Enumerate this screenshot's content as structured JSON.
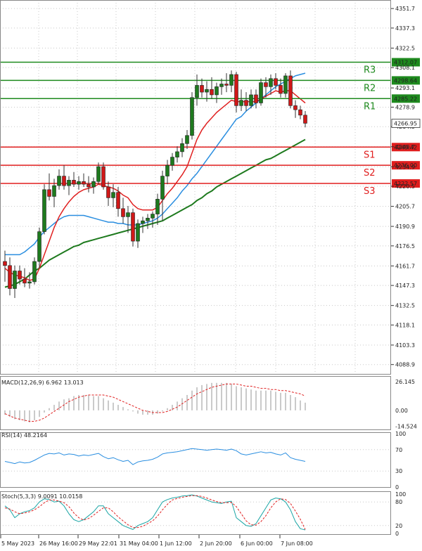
{
  "chart_data": {
    "type": "candlestick",
    "price_axis": {
      "ylim": [
        4082,
        4358
      ],
      "ticks": [
        4088.9,
        4103.3,
        4118.1,
        4132.5,
        4147.3,
        4161.7,
        4176.5,
        4190.9,
        4205.7,
        4220.5,
        4234.9,
        4249.7,
        4264.5,
        4278.9,
        4293.1,
        4308.1,
        4322.5,
        4337.3,
        4351.7
      ]
    },
    "x_labels": [
      "5 May 2023",
      "26 May 16:00",
      "29 May 22:01",
      "31 May 04:00",
      "1 Jun 12:00",
      "2 Jun 20:00",
      "6 Jun 00:00",
      "7 Jun 08:00"
    ],
    "levels": [
      {
        "name": "R3",
        "value": 4312.07,
        "value_label": "4312.07",
        "color": "#1e8a1e"
      },
      {
        "name": "R2",
        "value": 4298.64,
        "value_label": "4298.64",
        "color": "#1e8a1e"
      },
      {
        "name": "R1",
        "value": 4285.22,
        "value_label": "4285.22",
        "color": "#1e8a1e"
      },
      {
        "name": "S1",
        "value": 4249.42,
        "value_label": "4249.42",
        "color": "#e01e1e"
      },
      {
        "name": "S2",
        "value": 4236.0,
        "value_label": "4236.00",
        "color": "#e01e1e"
      },
      {
        "name": "S3",
        "value": 4222.57,
        "value_label": "4222.57",
        "color": "#e01e1e"
      }
    ],
    "current_price": {
      "value": 4266.95,
      "label": "4266.95"
    },
    "candles": [
      [
        4165,
        4173,
        4150,
        4162
      ],
      [
        4162,
        4168,
        4140,
        4145
      ],
      [
        4145,
        4162,
        4138,
        4158
      ],
      [
        4158,
        4162,
        4148,
        4152
      ],
      [
        4152,
        4160,
        4146,
        4149
      ],
      [
        4149,
        4157,
        4145,
        4150
      ],
      [
        4150,
        4168,
        4148,
        4165
      ],
      [
        4165,
        4190,
        4160,
        4187
      ],
      [
        4187,
        4222,
        4185,
        4218
      ],
      [
        4218,
        4230,
        4210,
        4213
      ],
      [
        4213,
        4226,
        4205,
        4221
      ],
      [
        4221,
        4233,
        4218,
        4228
      ],
      [
        4228,
        4236,
        4218,
        4221
      ],
      [
        4221,
        4228,
        4214,
        4225
      ],
      [
        4225,
        4231,
        4220,
        4222
      ],
      [
        4222,
        4228,
        4218,
        4224
      ],
      [
        4224,
        4230,
        4220,
        4222
      ],
      [
        4222,
        4228,
        4216,
        4220
      ],
      [
        4220,
        4227,
        4215,
        4224
      ],
      [
        4224,
        4238,
        4222,
        4235
      ],
      [
        4235,
        4238,
        4218,
        4220
      ],
      [
        4220,
        4224,
        4206,
        4212
      ],
      [
        4212,
        4222,
        4205,
        4216
      ],
      [
        4216,
        4220,
        4198,
        4204
      ],
      [
        4204,
        4212,
        4193,
        4198
      ],
      [
        4198,
        4206,
        4186,
        4201
      ],
      [
        4201,
        4204,
        4176,
        4180
      ],
      [
        4180,
        4196,
        4175,
        4193
      ],
      [
        4193,
        4198,
        4186,
        4195
      ],
      [
        4195,
        4200,
        4189,
        4197
      ],
      [
        4197,
        4202,
        4190,
        4200
      ],
      [
        4200,
        4215,
        4192,
        4211
      ],
      [
        4211,
        4232,
        4195,
        4228
      ],
      [
        4228,
        4240,
        4222,
        4236
      ],
      [
        4236,
        4245,
        4232,
        4242
      ],
      [
        4242,
        4250,
        4238,
        4246
      ],
      [
        4246,
        4256,
        4242,
        4252
      ],
      [
        4252,
        4262,
        4248,
        4258
      ],
      [
        4258,
        4290,
        4255,
        4286
      ],
      [
        4286,
        4303,
        4280,
        4295
      ],
      [
        4295,
        4300,
        4286,
        4290
      ],
      [
        4290,
        4298,
        4283,
        4292
      ],
      [
        4292,
        4301,
        4285,
        4288
      ],
      [
        4288,
        4297,
        4282,
        4294
      ],
      [
        4294,
        4300,
        4288,
        4296
      ],
      [
        4296,
        4304,
        4290,
        4295
      ],
      [
        4295,
        4306,
        4290,
        4303
      ],
      [
        4303,
        4305,
        4275,
        4280
      ],
      [
        4280,
        4292,
        4276,
        4284
      ],
      [
        4284,
        4290,
        4276,
        4280
      ],
      [
        4280,
        4292,
        4278,
        4288
      ],
      [
        4288,
        4292,
        4278,
        4282
      ],
      [
        4282,
        4300,
        4280,
        4297
      ],
      [
        4297,
        4301,
        4286,
        4294
      ],
      [
        4294,
        4303,
        4288,
        4300
      ],
      [
        4300,
        4304,
        4292,
        4295
      ],
      [
        4295,
        4300,
        4286,
        4289
      ],
      [
        4289,
        4304,
        4286,
        4302
      ],
      [
        4302,
        4306,
        4278,
        4280
      ],
      [
        4280,
        4284,
        4271,
        4277
      ],
      [
        4277,
        4280,
        4270,
        4273
      ],
      [
        4273,
        4276,
        4264,
        4267
      ]
    ],
    "ema_red": [
      4160,
      4157,
      4155,
      4154,
      4153,
      4151,
      4152,
      4160,
      4170,
      4180,
      4190,
      4198,
      4204,
      4209,
      4213,
      4216,
      4218,
      4219,
      4220,
      4222,
      4221,
      4220,
      4219,
      4217,
      4214,
      4212,
      4207,
      4204,
      4203,
      4203,
      4203,
      4205,
      4210,
      4215,
      4219,
      4224,
      4229,
      4235,
      4245,
      4255,
      4262,
      4267,
      4271,
      4275,
      4278,
      4281,
      4284,
      4283,
      4283,
      4283,
      4283,
      4283,
      4285,
      4287,
      4289,
      4291,
      4290,
      4291,
      4291,
      4288,
      4285,
      4282
    ],
    "ma_blue": [
      4170,
      4170,
      4170,
      4170,
      4172,
      4175,
      4178,
      4183,
      4187,
      4190,
      4193,
      4196,
      4198,
      4199,
      4199,
      4199,
      4199,
      4198,
      4197,
      4196,
      4195,
      4194,
      4194,
      4193,
      4193,
      4192,
      4192,
      4192,
      4193,
      4194,
      4195,
      4197,
      4200,
      4204,
      4208,
      4212,
      4217,
      4221,
      4226,
      4230,
      4235,
      4240,
      4245,
      4250,
      4255,
      4260,
      4265,
      4270,
      4272,
      4276,
      4279,
      4282,
      4285,
      4288,
      4291,
      4294,
      4296,
      4298,
      4300,
      4302,
      4303,
      4304
    ],
    "ma_green": [
      4146,
      4147,
      4148,
      4150,
      4152,
      4155,
      4158,
      4160,
      4163,
      4166,
      4168,
      4170,
      4172,
      4174,
      4176,
      4177,
      4179,
      4180,
      4181,
      4182,
      4183,
      4184,
      4185,
      4186,
      4187,
      4188,
      4189,
      4190,
      4191,
      4192,
      4193,
      4194,
      4195,
      4197,
      4199,
      4201,
      4203,
      4205,
      4207,
      4210,
      4212,
      4215,
      4217,
      4220,
      4222,
      4224,
      4226,
      4228,
      4230,
      4232,
      4234,
      4236,
      4238,
      4240,
      4241,
      4243,
      4245,
      4247,
      4249,
      4251,
      4253,
      4255
    ],
    "macd": {
      "title": "MACD(12,26,9) 6.962 13.013",
      "ylim": [
        -18,
        30
      ],
      "ticks": [
        26.145,
        0.0,
        -14.524
      ],
      "tick_labels": [
        "26.145",
        "0.00",
        "-14.524"
      ],
      "histogram": [
        -4,
        -6,
        -8,
        -9,
        -10,
        -11,
        -9,
        -6,
        -2,
        2,
        5,
        8,
        10,
        11,
        13,
        14,
        14,
        14,
        13,
        13,
        11,
        9,
        7,
        5,
        3,
        1,
        -1,
        -3,
        -4,
        -4,
        -4,
        -3,
        -1,
        2,
        5,
        8,
        11,
        14,
        18,
        21,
        23,
        24,
        25,
        25,
        25,
        25,
        24,
        22,
        21,
        20,
        19,
        18,
        18,
        18,
        18,
        17,
        16,
        16,
        14,
        12,
        9,
        7
      ],
      "signal": [
        -3,
        -5,
        -7,
        -8,
        -9,
        -10,
        -10,
        -9,
        -7,
        -4,
        -1,
        2,
        5,
        8,
        10,
        12,
        13,
        14,
        14,
        14,
        14,
        13,
        12,
        10,
        8,
        6,
        4,
        2,
        0,
        -1,
        -2,
        -2,
        -2,
        -1,
        1,
        3,
        6,
        9,
        12,
        15,
        17,
        19,
        21,
        22,
        23,
        24,
        24,
        24,
        23,
        22,
        22,
        21,
        20,
        20,
        19,
        19,
        18,
        18,
        17,
        16,
        15,
        13
      ]
    },
    "rsi": {
      "title": "RSI(14) 48.2164",
      "ylim": [
        0,
        100
      ],
      "ticks": [
        100,
        70,
        30,
        0
      ],
      "tick_labels": [
        "100",
        "70",
        "30",
        "0"
      ],
      "values": [
        48,
        46,
        44,
        47,
        45,
        46,
        50,
        55,
        60,
        63,
        62,
        64,
        60,
        62,
        61,
        58,
        60,
        59,
        61,
        63,
        57,
        53,
        55,
        51,
        48,
        50,
        42,
        47,
        49,
        50,
        52,
        56,
        62,
        64,
        65,
        66,
        68,
        70,
        72,
        71,
        70,
        69,
        70,
        71,
        70,
        69,
        71,
        68,
        62,
        60,
        62,
        64,
        66,
        64,
        65,
        62,
        60,
        64,
        55,
        52,
        50,
        48
      ]
    },
    "stoch": {
      "title": "Stoch(5,3,3) 9.0091 10.0158",
      "ylim": [
        0,
        100
      ],
      "ticks": [
        100,
        80,
        20,
        0
      ],
      "tick_labels": [
        "100",
        "80",
        "20",
        "0"
      ],
      "k": [
        70,
        60,
        40,
        50,
        55,
        58,
        65,
        80,
        88,
        86,
        80,
        82,
        70,
        50,
        35,
        30,
        35,
        45,
        55,
        70,
        70,
        50,
        40,
        30,
        20,
        15,
        10,
        20,
        25,
        30,
        40,
        60,
        80,
        86,
        90,
        92,
        95,
        96,
        98,
        95,
        90,
        85,
        80,
        78,
        76,
        80,
        82,
        40,
        30,
        20,
        18,
        25,
        45,
        65,
        85,
        90,
        88,
        80,
        60,
        30,
        12,
        9
      ],
      "d": [
        65,
        62,
        55,
        50,
        52,
        55,
        60,
        68,
        78,
        85,
        85,
        82,
        78,
        68,
        52,
        40,
        34,
        38,
        46,
        56,
        65,
        65,
        55,
        42,
        32,
        22,
        15,
        15,
        18,
        25,
        32,
        44,
        60,
        74,
        85,
        89,
        92,
        94,
        96,
        96,
        94,
        90,
        85,
        81,
        78,
        78,
        79,
        68,
        50,
        32,
        22,
        21,
        30,
        45,
        65,
        80,
        88,
        86,
        76,
        57,
        36,
        10
      ]
    }
  }
}
